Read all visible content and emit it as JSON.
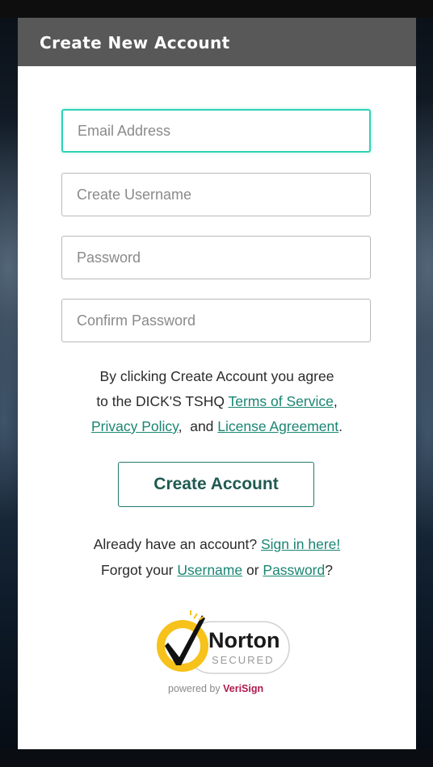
{
  "header": {
    "title": "Create New Account"
  },
  "form": {
    "email": {
      "placeholder": "Email Address",
      "value": ""
    },
    "username": {
      "placeholder": "Create Username",
      "value": ""
    },
    "password": {
      "placeholder": "Password",
      "value": ""
    },
    "confirm_password": {
      "placeholder": "Confirm Password",
      "value": ""
    }
  },
  "terms": {
    "line1": "By clicking Create Account you agree",
    "line2_prefix": "to the DICK'S TSHQ ",
    "terms_link": "Terms of Service",
    "comma": ",",
    "privacy_link": "Privacy Policy",
    "and_text": ",  and ",
    "license_link": "License Agreement",
    "period": "."
  },
  "create_button": {
    "label": "Create Account"
  },
  "signin": {
    "prefix": "Already have an account? ",
    "signin_link": "Sign in here!",
    "forgot_prefix": "Forgot your ",
    "username_link": "Username",
    "or_text": " or ",
    "password_link": "Password",
    "question": "?"
  },
  "badge": {
    "brand": "Norton",
    "secured": "SECURED",
    "powered_prefix": "powered by ",
    "powered_brand": "VeriSign",
    "icon": "norton-check-icon",
    "colors": {
      "ring": "#f6c21b",
      "check": "#111111",
      "verisign": "#b0174e"
    }
  },
  "colors": {
    "header_bg": "#585858",
    "link": "#198573",
    "focus": "#2fd3b5",
    "button_border": "#1f7a6a"
  }
}
